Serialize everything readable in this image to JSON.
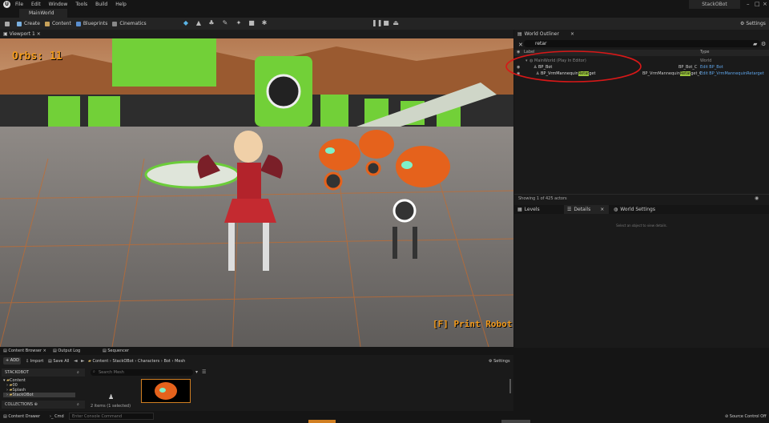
{
  "menubar": {
    "items": [
      "File",
      "Edit",
      "Window",
      "Tools",
      "Build",
      "Help"
    ],
    "project": "StackOBot"
  },
  "tabs": {
    "level": "MainWorld"
  },
  "toolbar": {
    "create": "Create",
    "content": "Content",
    "blueprints": "Blueprints",
    "cinematics": "Cinematics",
    "settings": "Settings"
  },
  "viewport": {
    "tab": "Viewport 1",
    "orbs": "Orbs:  11",
    "print_prompt": "[F]  Print  Robot"
  },
  "outliner": {
    "tab": "World Outliner",
    "search_value": "retar",
    "col_label": "Label",
    "col_type": "Type",
    "rows": [
      {
        "label": "MainWorld (Play In Editor)",
        "type": "World"
      },
      {
        "label": "BP_Bot",
        "class": "BP_Bot_C",
        "edit": "Edit BP_Bot"
      },
      {
        "label_pre": "BP_VrmMannequin",
        "label_hl": "Retar",
        "label_post": "get",
        "class_pre": "BP_VrmMannequin",
        "class_hl": "Retar",
        "class_post": "get_C",
        "edit": "Edit BP_VrmMannequinRetarget"
      }
    ],
    "footer": "Showing 1 of 425 actors"
  },
  "details": {
    "tabs": [
      "Levels",
      "Details",
      "World Settings"
    ],
    "empty": "Select an object to view details."
  },
  "bottom": {
    "tabs": [
      "Content Browser",
      "Output Log",
      "Sequencer"
    ],
    "add": "ADD",
    "import": "Import",
    "save_all": "Save All",
    "breadcrumb": [
      "Content",
      "StackOBot",
      "Characters",
      "Bot",
      "Mesh"
    ],
    "settings": "Settings",
    "project_header": "STACKOBOT",
    "tree": [
      "Content",
      "00",
      "Splash",
      "StackOBot"
    ],
    "collections": "COLLECTIONS",
    "search_placeholder": "Search Mesh",
    "status": "2 items (1 selected)"
  },
  "status": {
    "drawer": "Content Drawer",
    "cmd": "Cmd",
    "console_placeholder": "Enter Console Command",
    "source_control": "Source Control Off"
  }
}
